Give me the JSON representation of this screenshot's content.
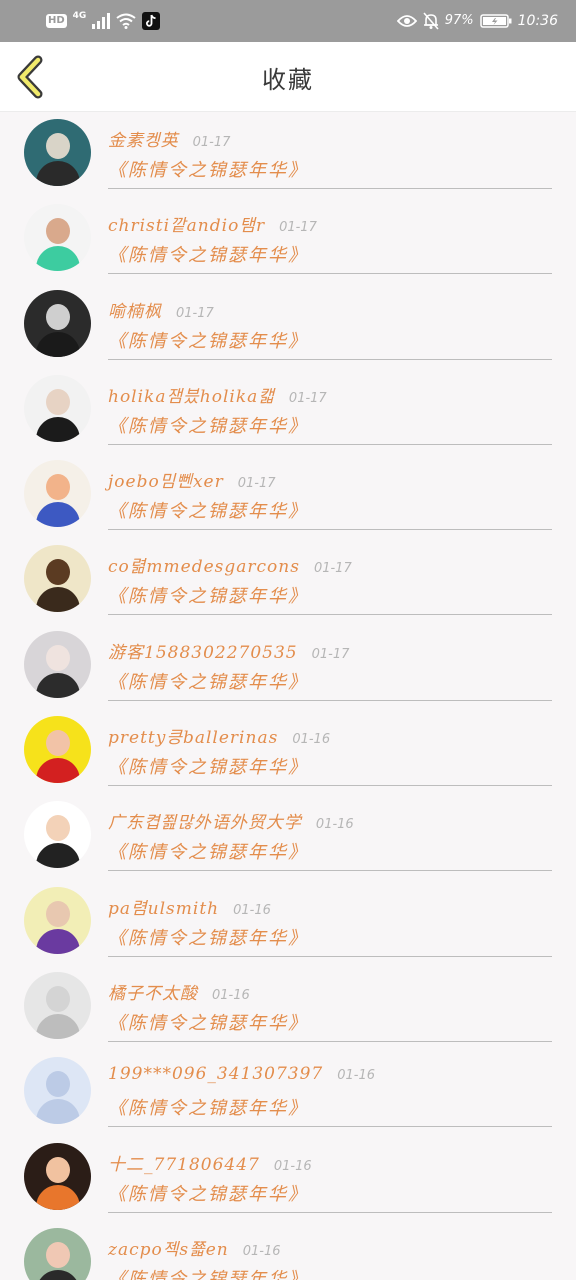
{
  "status_bar": {
    "hd": "HD",
    "network": "4G",
    "battery_percent": "97%",
    "time": "10:36",
    "icons": [
      "signal-icon",
      "wifi-icon",
      "tiktok-icon",
      "eye-icon",
      "bell-off-icon",
      "battery-icon"
    ]
  },
  "header": {
    "title": "收藏",
    "back_icon": "chevron-left-icon"
  },
  "colors": {
    "accent": "#e38d4c",
    "status_bar_bg": "#9b9b9b",
    "divider": "#bdbdbd",
    "date": "#b6b6b6"
  },
  "items": [
    {
      "name": "金素켕英",
      "date": "01-17",
      "work": "《陈情令之锦瑟年华》",
      "avatar_colors": [
        "#2f6b73",
        "#d9d4c8",
        "#2a2a2a"
      ]
    },
    {
      "name": "christi깥andio탬r",
      "date": "01-17",
      "work": "《陈情令之锦瑟年华》",
      "avatar_colors": [
        "#f4f4f4",
        "#d9a98c",
        "#3dcca0"
      ]
    },
    {
      "name": "喻楠枫",
      "date": "01-17",
      "work": "《陈情令之锦瑟年华》",
      "avatar_colors": [
        "#2b2b2b",
        "#cfcfcf",
        "#1a1a1a"
      ]
    },
    {
      "name": "holika잼븠holika캛",
      "date": "01-17",
      "work": "《陈情令之锦瑟年华》",
      "avatar_colors": [
        "#f2f2f2",
        "#e7d3c4",
        "#1b1b1b"
      ]
    },
    {
      "name": "joebo밈뻰xer",
      "date": "01-17",
      "work": "《陈情令之锦瑟年华》",
      "avatar_colors": [
        "#f5f0e8",
        "#f2b38a",
        "#3d59c2"
      ]
    },
    {
      "name": "co렮mmedesgarcons",
      "date": "01-17",
      "work": "《陈情令之锦瑟年华》",
      "avatar_colors": [
        "#efe6c8",
        "#5b3b22",
        "#3a2a1c"
      ]
    },
    {
      "name": "游客1588302270535",
      "date": "01-17",
      "work": "《陈情令之锦瑟年华》",
      "avatar_colors": [
        "#d8d5d8",
        "#efe3df",
        "#2c2c2c"
      ]
    },
    {
      "name": "pretty킁ballerinas",
      "date": "01-16",
      "work": "《陈情令之锦瑟年华》",
      "avatar_colors": [
        "#f6e21b",
        "#f2c3a7",
        "#d32020"
      ]
    },
    {
      "name": "广东켭쬞많外语外贸大学",
      "date": "01-16",
      "work": "《陈情令之锦瑟年华》",
      "avatar_colors": [
        "#ffffff",
        "#f3d2b8",
        "#222222"
      ]
    },
    {
      "name": "pa렴ulsmith",
      "date": "01-16",
      "work": "《陈情令之锦瑟年华》",
      "avatar_colors": [
        "#f2eeb6",
        "#e8c8b0",
        "#6a3aa0"
      ]
    },
    {
      "name": "橘子不太酸",
      "date": "01-16",
      "work": "《陈情令之锦瑟年华》",
      "avatar_colors": [
        "#e6e6e6",
        "#d4d4d4",
        "#bdbdbd"
      ]
    },
    {
      "name": "199***096_341307397",
      "date": "01-16",
      "work": "《陈情令之锦瑟年华》",
      "avatar_colors": [
        "#dde6f5",
        "#bccbe6",
        "#bccbe6"
      ]
    },
    {
      "name": "十二_771806447",
      "date": "01-16",
      "work": "《陈情令之锦瑟年华》",
      "avatar_colors": [
        "#2b1d17",
        "#f1c2a0",
        "#e8762c"
      ]
    },
    {
      "name": "zacpo젝s쬷en",
      "date": "01-16",
      "work": "《陈情令之锦瑟年华》",
      "avatar_colors": [
        "#9bb89e",
        "#f0c8b4",
        "#2a2a2a"
      ]
    }
  ]
}
